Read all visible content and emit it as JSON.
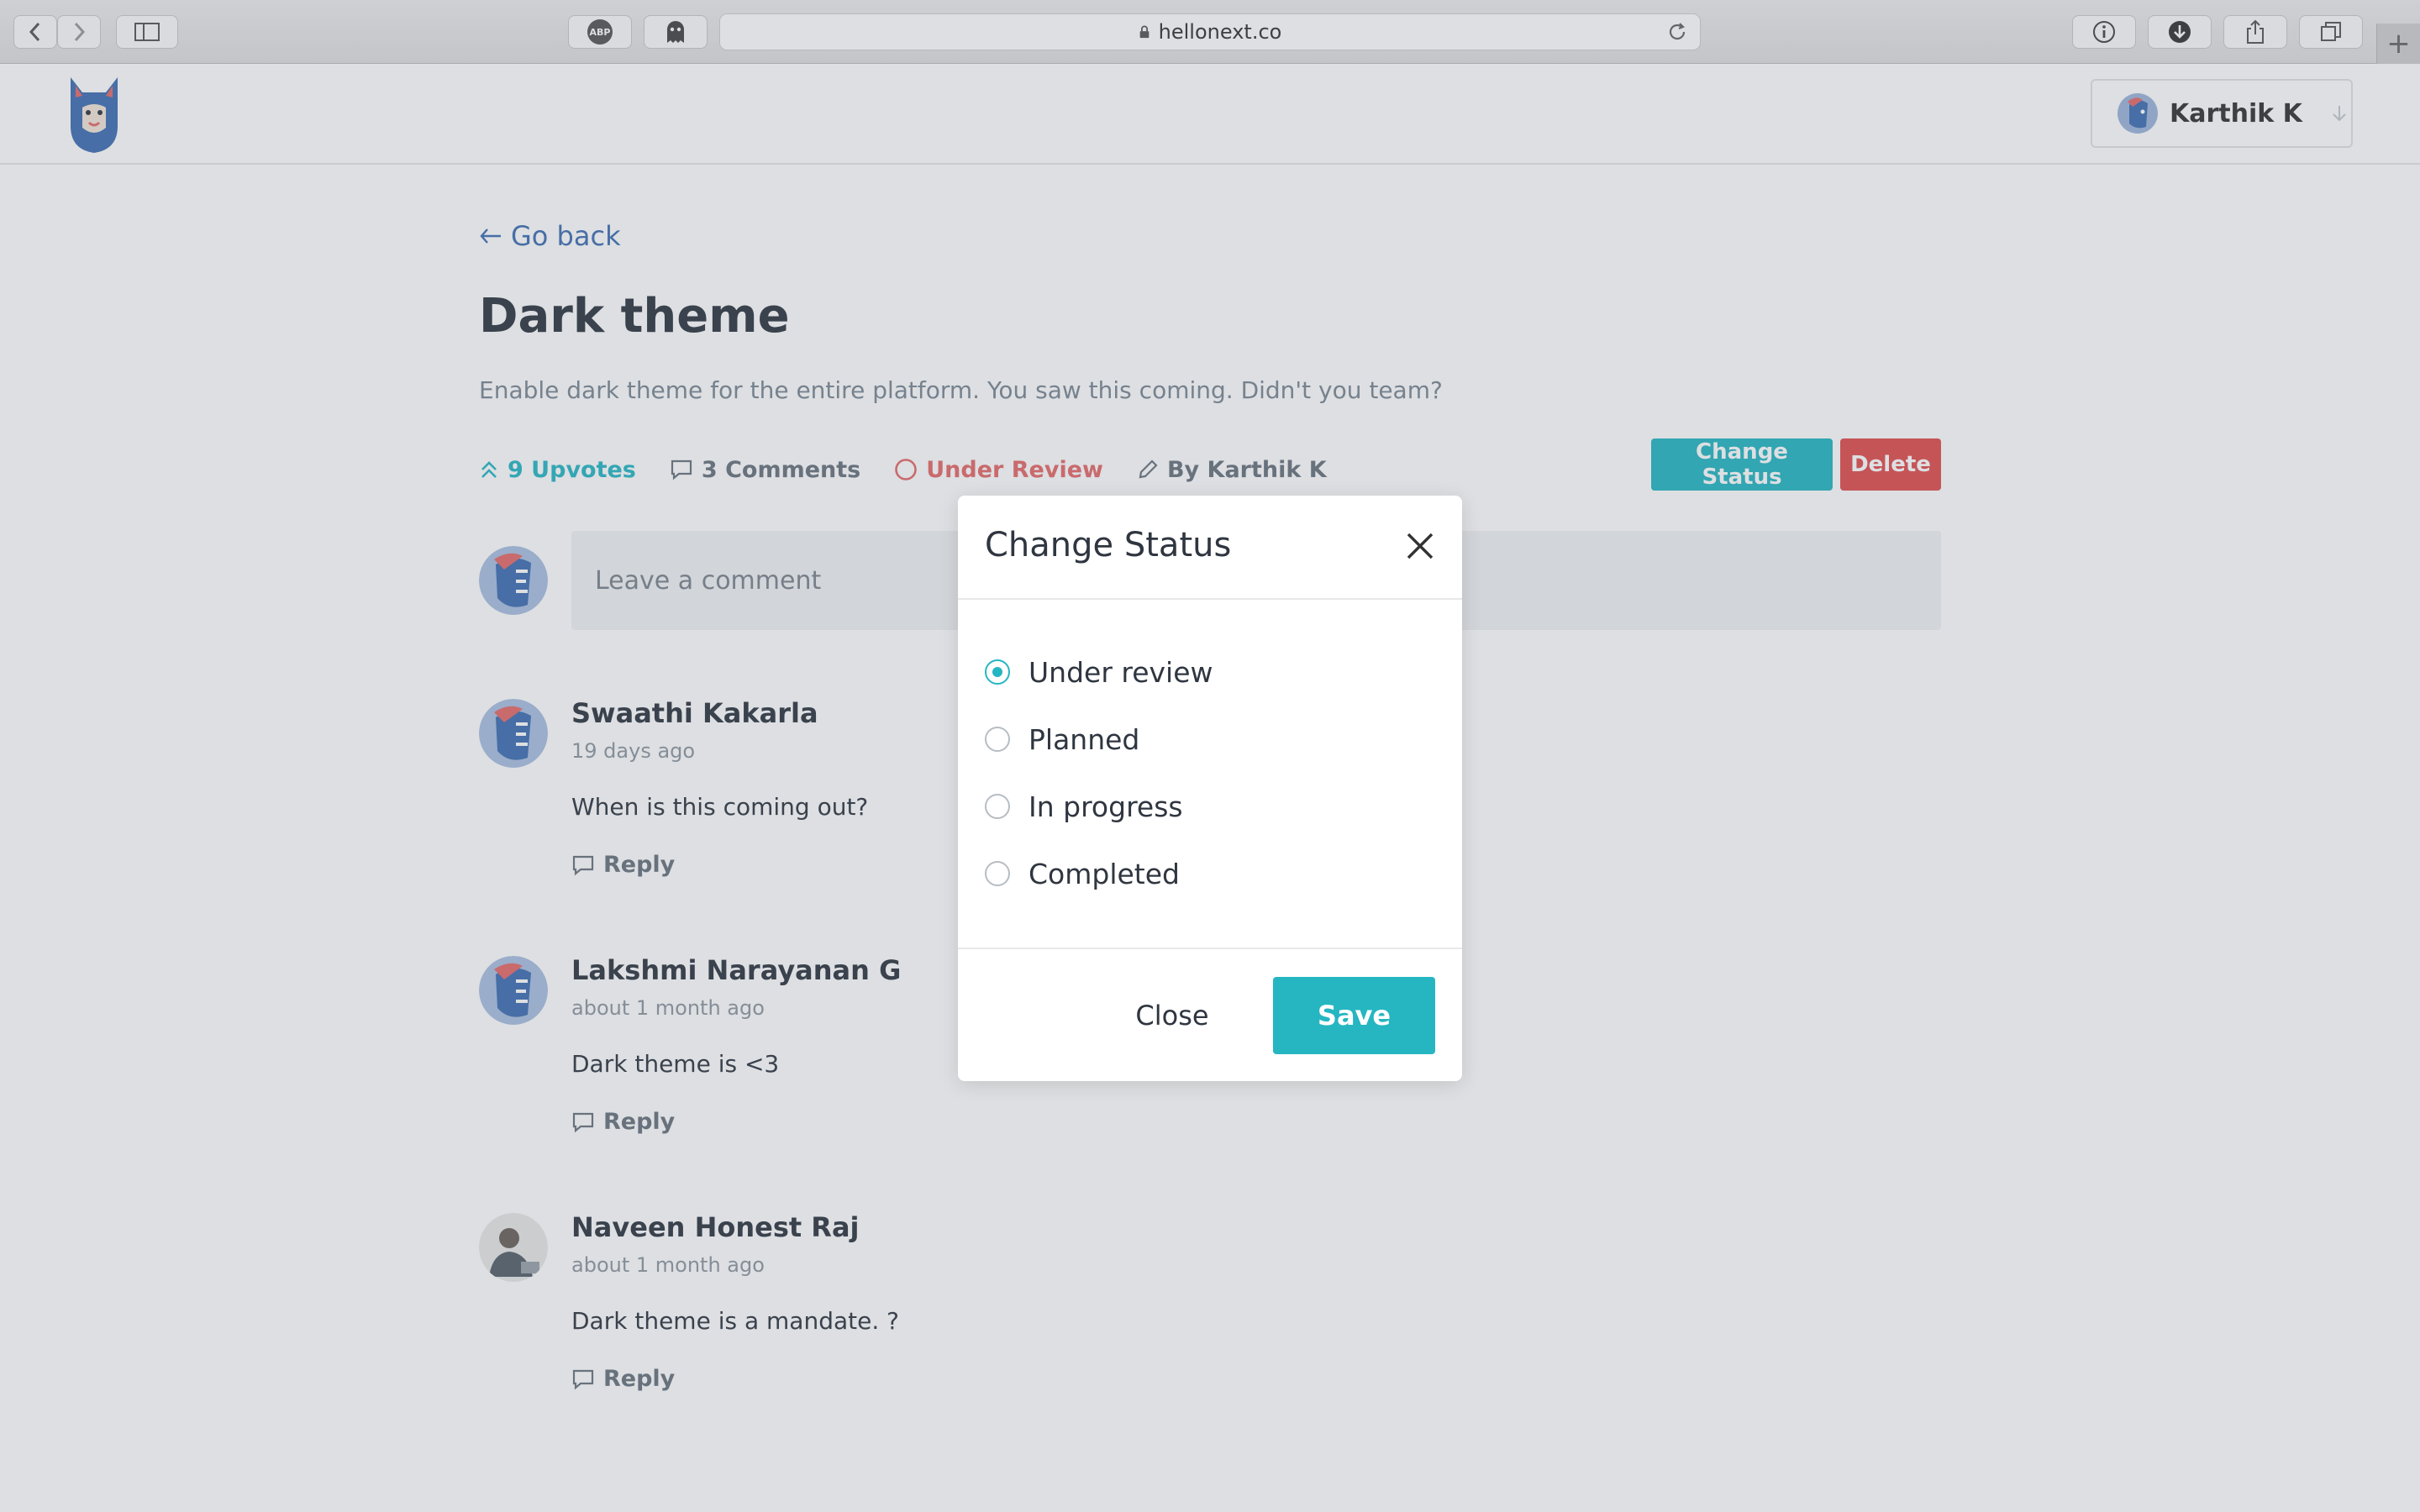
{
  "browser": {
    "url": "hellonext.co",
    "abp_label": "ABP",
    "new_tab": "+"
  },
  "header": {
    "user_name": "Karthik K"
  },
  "post": {
    "back_label": "Go back",
    "title": "Dark theme",
    "description": "Enable dark theme for the entire platform. You saw this coming. Didn't you team?",
    "upvotes": "9 Upvotes",
    "comments_count": "3 Comments",
    "status": "Under Review",
    "author": "By Karthik K",
    "change_status_label": "Change Status",
    "delete_label": "Delete"
  },
  "comment_input": {
    "placeholder": "Leave a comment"
  },
  "comments": [
    {
      "name": "Swaathi Kakarla",
      "time": "19 days ago",
      "text": "When is this coming out?",
      "reply": "Reply"
    },
    {
      "name": "Lakshmi Narayanan G",
      "time": "about 1 month ago",
      "text": "Dark theme is <3",
      "reply": "Reply"
    },
    {
      "name": "Naveen Honest Raj",
      "time": "about 1 month ago",
      "text": "Dark theme is a mandate. ?",
      "reply": "Reply"
    }
  ],
  "modal": {
    "title": "Change Status",
    "options": [
      {
        "label": "Under review",
        "selected": true
      },
      {
        "label": "Planned",
        "selected": false
      },
      {
        "label": "In progress",
        "selected": false
      },
      {
        "label": "Completed",
        "selected": false
      }
    ],
    "close_label": "Close",
    "save_label": "Save"
  },
  "colors": {
    "accent": "#25b6c2",
    "danger": "#e14d4d",
    "status_review": "#e66a6a",
    "link": "#3f6fb3"
  }
}
